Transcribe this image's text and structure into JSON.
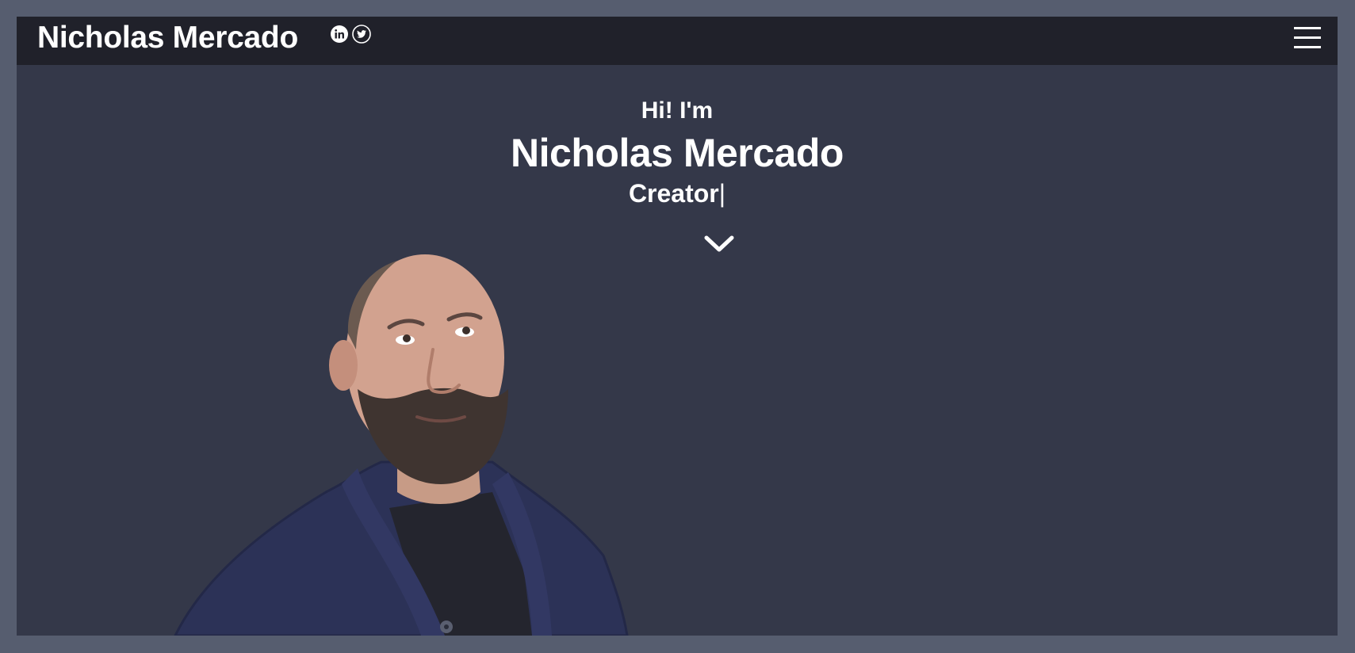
{
  "navbar": {
    "brand": "Nicholas Mercado",
    "social": [
      {
        "icon": "linkedin-icon"
      },
      {
        "icon": "twitter-icon"
      }
    ],
    "menu_icon": "hamburger-menu-icon"
  },
  "hero": {
    "greeting": "Hi! I'm",
    "name": "Nicholas Mercado",
    "role": "Creator",
    "cursor": "|",
    "scroll_icon": "chevron-down-icon"
  },
  "colors": {
    "page_border": "#565d6f",
    "background": "#343849",
    "navbar": "#20212a",
    "text": "#ffffff"
  }
}
